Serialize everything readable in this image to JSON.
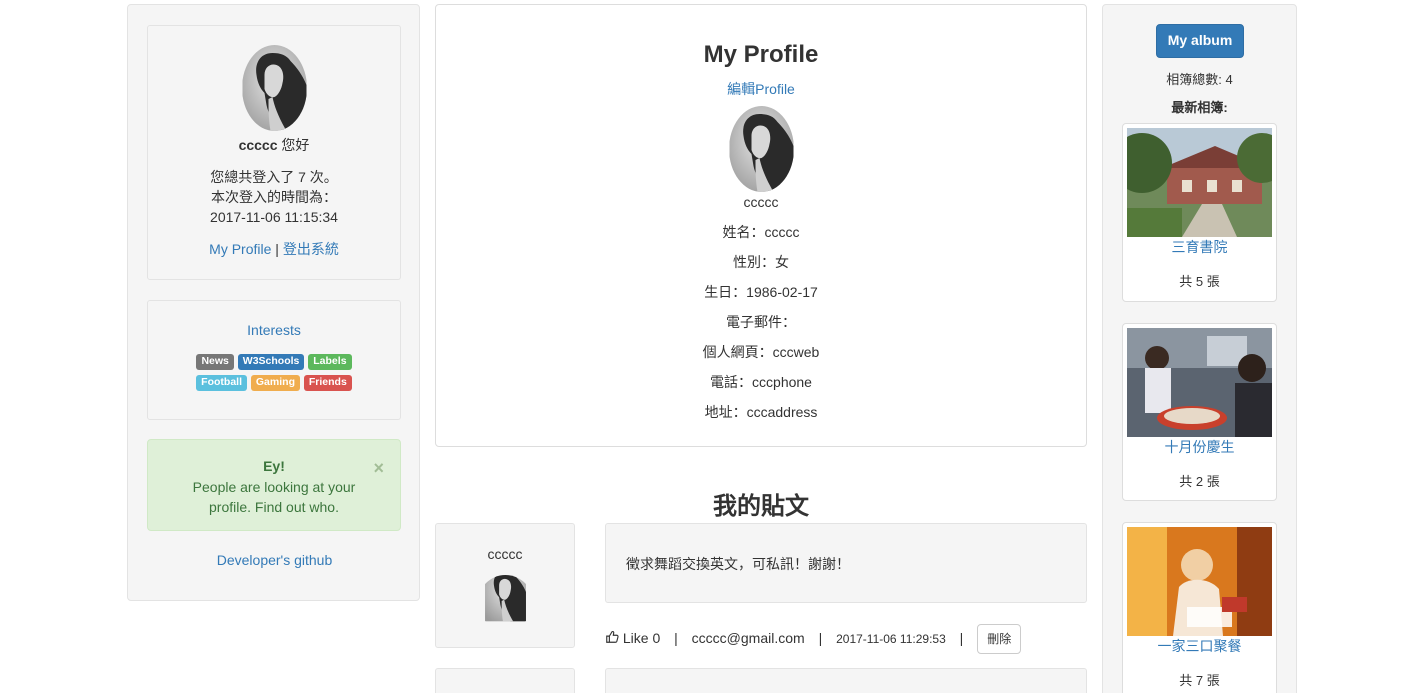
{
  "left": {
    "username": "ccccc",
    "greeting": "您好",
    "login_count_text": "您總共登入了 7 次。",
    "login_time_label": "本次登入的時間為：",
    "login_time": "2017-11-06 11:15:34",
    "my_profile_link": "My Profile",
    "separator": "|",
    "logout_link": "登出系統",
    "interests_title": "Interests",
    "interests": [
      {
        "label": "News",
        "color": "#777777"
      },
      {
        "label": "W3Schools",
        "color": "#337ab7"
      },
      {
        "label": "Labels",
        "color": "#5cb85c"
      },
      {
        "label": "Football",
        "color": "#5bc0de"
      },
      {
        "label": "Gaming",
        "color": "#f0ad4e"
      },
      {
        "label": "Friends",
        "color": "#d9534f"
      }
    ],
    "alert_title": "Ey!",
    "alert_text": "People are looking at your profile. Find out who.",
    "alert_close": "×",
    "github_link": "Developer's github"
  },
  "profile": {
    "title": "My Profile",
    "edit_link": "編輯Profile",
    "username": "ccccc",
    "name": "姓名：ccccc",
    "gender": "性別：女",
    "birthday": "生日：1986-02-17",
    "email": "電子郵件：",
    "homepage": "個人網頁：cccweb",
    "phone": "電話：cccphone",
    "address": "地址：cccaddress"
  },
  "posts": {
    "title": "我的貼文",
    "items": [
      {
        "author": "ccccc",
        "content": "徵求舞蹈交換英文，可私訊！謝謝！",
        "like_label": "Like 0",
        "email": "ccccc@gmail.com",
        "timestamp": "2017-11-06 11:29:53",
        "delete_label": "刪除",
        "sep": "|"
      }
    ]
  },
  "album": {
    "button_label": "My album",
    "total_label": "相簿總數: 4",
    "latest_label": "最新相簿:",
    "items": [
      {
        "name": "三育書院",
        "count": "共 5 張"
      },
      {
        "name": "十月份慶生",
        "count": "共 2 張"
      },
      {
        "name": "一家三口聚餐",
        "count": "共 7 張"
      }
    ]
  },
  "icons": {
    "avatar": "portrait-avatar",
    "like": "thumbs-up-icon",
    "close": "close-icon"
  }
}
